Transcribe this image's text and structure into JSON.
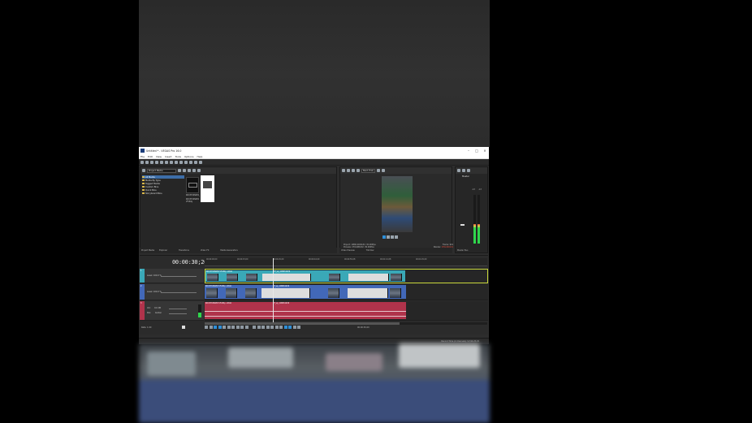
{
  "window": {
    "title": "Untitled * - VEGAS Pro 16.0",
    "minimize": "–",
    "maximize": "□",
    "close": "×"
  },
  "menu": [
    "File",
    "Edit",
    "View",
    "Insert",
    "Tools",
    "Options",
    "Help"
  ],
  "explorer": {
    "dropdown": "Project Media",
    "tree": [
      "All Media",
      "Media By Type",
      "Tagged Media",
      "Custom Bins",
      "Quick Bins",
      "Storyboard Bins"
    ],
    "thumbs": [
      {
        "label": "KDX3YCZSKE4_"
      },
      {
        "label": "KDX3YCZSKE4 VFx84y"
      }
    ],
    "info_line1": "Video: 1080x1920x32, 30.000 fps, 00:01:42;00, Alpha = None, Field Order = None (progressive scan), HD",
    "info_line2": "Audio: 48,000 Hz, Stereo, 00:00:30;27, AAC",
    "tabs": [
      "Project Media",
      "Explorer",
      "Transitions",
      "Video FX",
      "Media Generators"
    ]
  },
  "preview": {
    "dropdown": "Best (Full)",
    "project_label": "Project:",
    "project_value": "1080x1920x32, 30.000fps",
    "preview_label": "Preview:",
    "preview_value": "270x480x32, 30.000fps",
    "frame_label": "Frame:",
    "frame_value": "919",
    "display_label": "Display:",
    "display_value": "135x240x32",
    "tabs": [
      "Video Preview",
      "Trimmer"
    ]
  },
  "master": {
    "title": "Master",
    "scale_left": "-Inf.",
    "scale_right": "-Inf.",
    "footer": "Master Bus"
  },
  "timeline": {
    "timecode": "00:00:30;20",
    "ticks": [
      "00:00:00;00",
      "00:00:15;00",
      "00:00:29;29",
      "00:00:44;29",
      "00:00:59;28",
      "00:01:14;28",
      "00:01:29;29"
    ],
    "tracks": [
      {
        "num": "1",
        "label": "Level: 100.0 %",
        "clip1": "KDX3YCZSKE4 VFx84y -LBUA",
        "clip2": "P7_vp_1080h1929"
      },
      {
        "num": "2",
        "label": "Level: 100.0 %",
        "clip1": "KDX3YCZSKE4 VFx84y -LBUA",
        "clip2": "P7_vp_1080h1929"
      },
      {
        "num": "3",
        "label_vol": "Vol:",
        "vol_value": "0.0 dB",
        "label_pan": "Pan:",
        "pan_value": "Center",
        "clip1": "KDX3YCZSKE4 VFx84y -LBUA",
        "clip2": "P7_vp_1080h1929"
      }
    ],
    "rate": "Rate: 1.00",
    "counter": "00:00:30;20",
    "status": "Record Time (2 channels): 9,742:25:29"
  },
  "colors": {
    "video_track_1": "#3aa8b7",
    "video_track_2": "#4268b8",
    "audio_track": "#b0334b",
    "clip_selected": "#c7d63a",
    "accent": "#2f8fd8"
  }
}
